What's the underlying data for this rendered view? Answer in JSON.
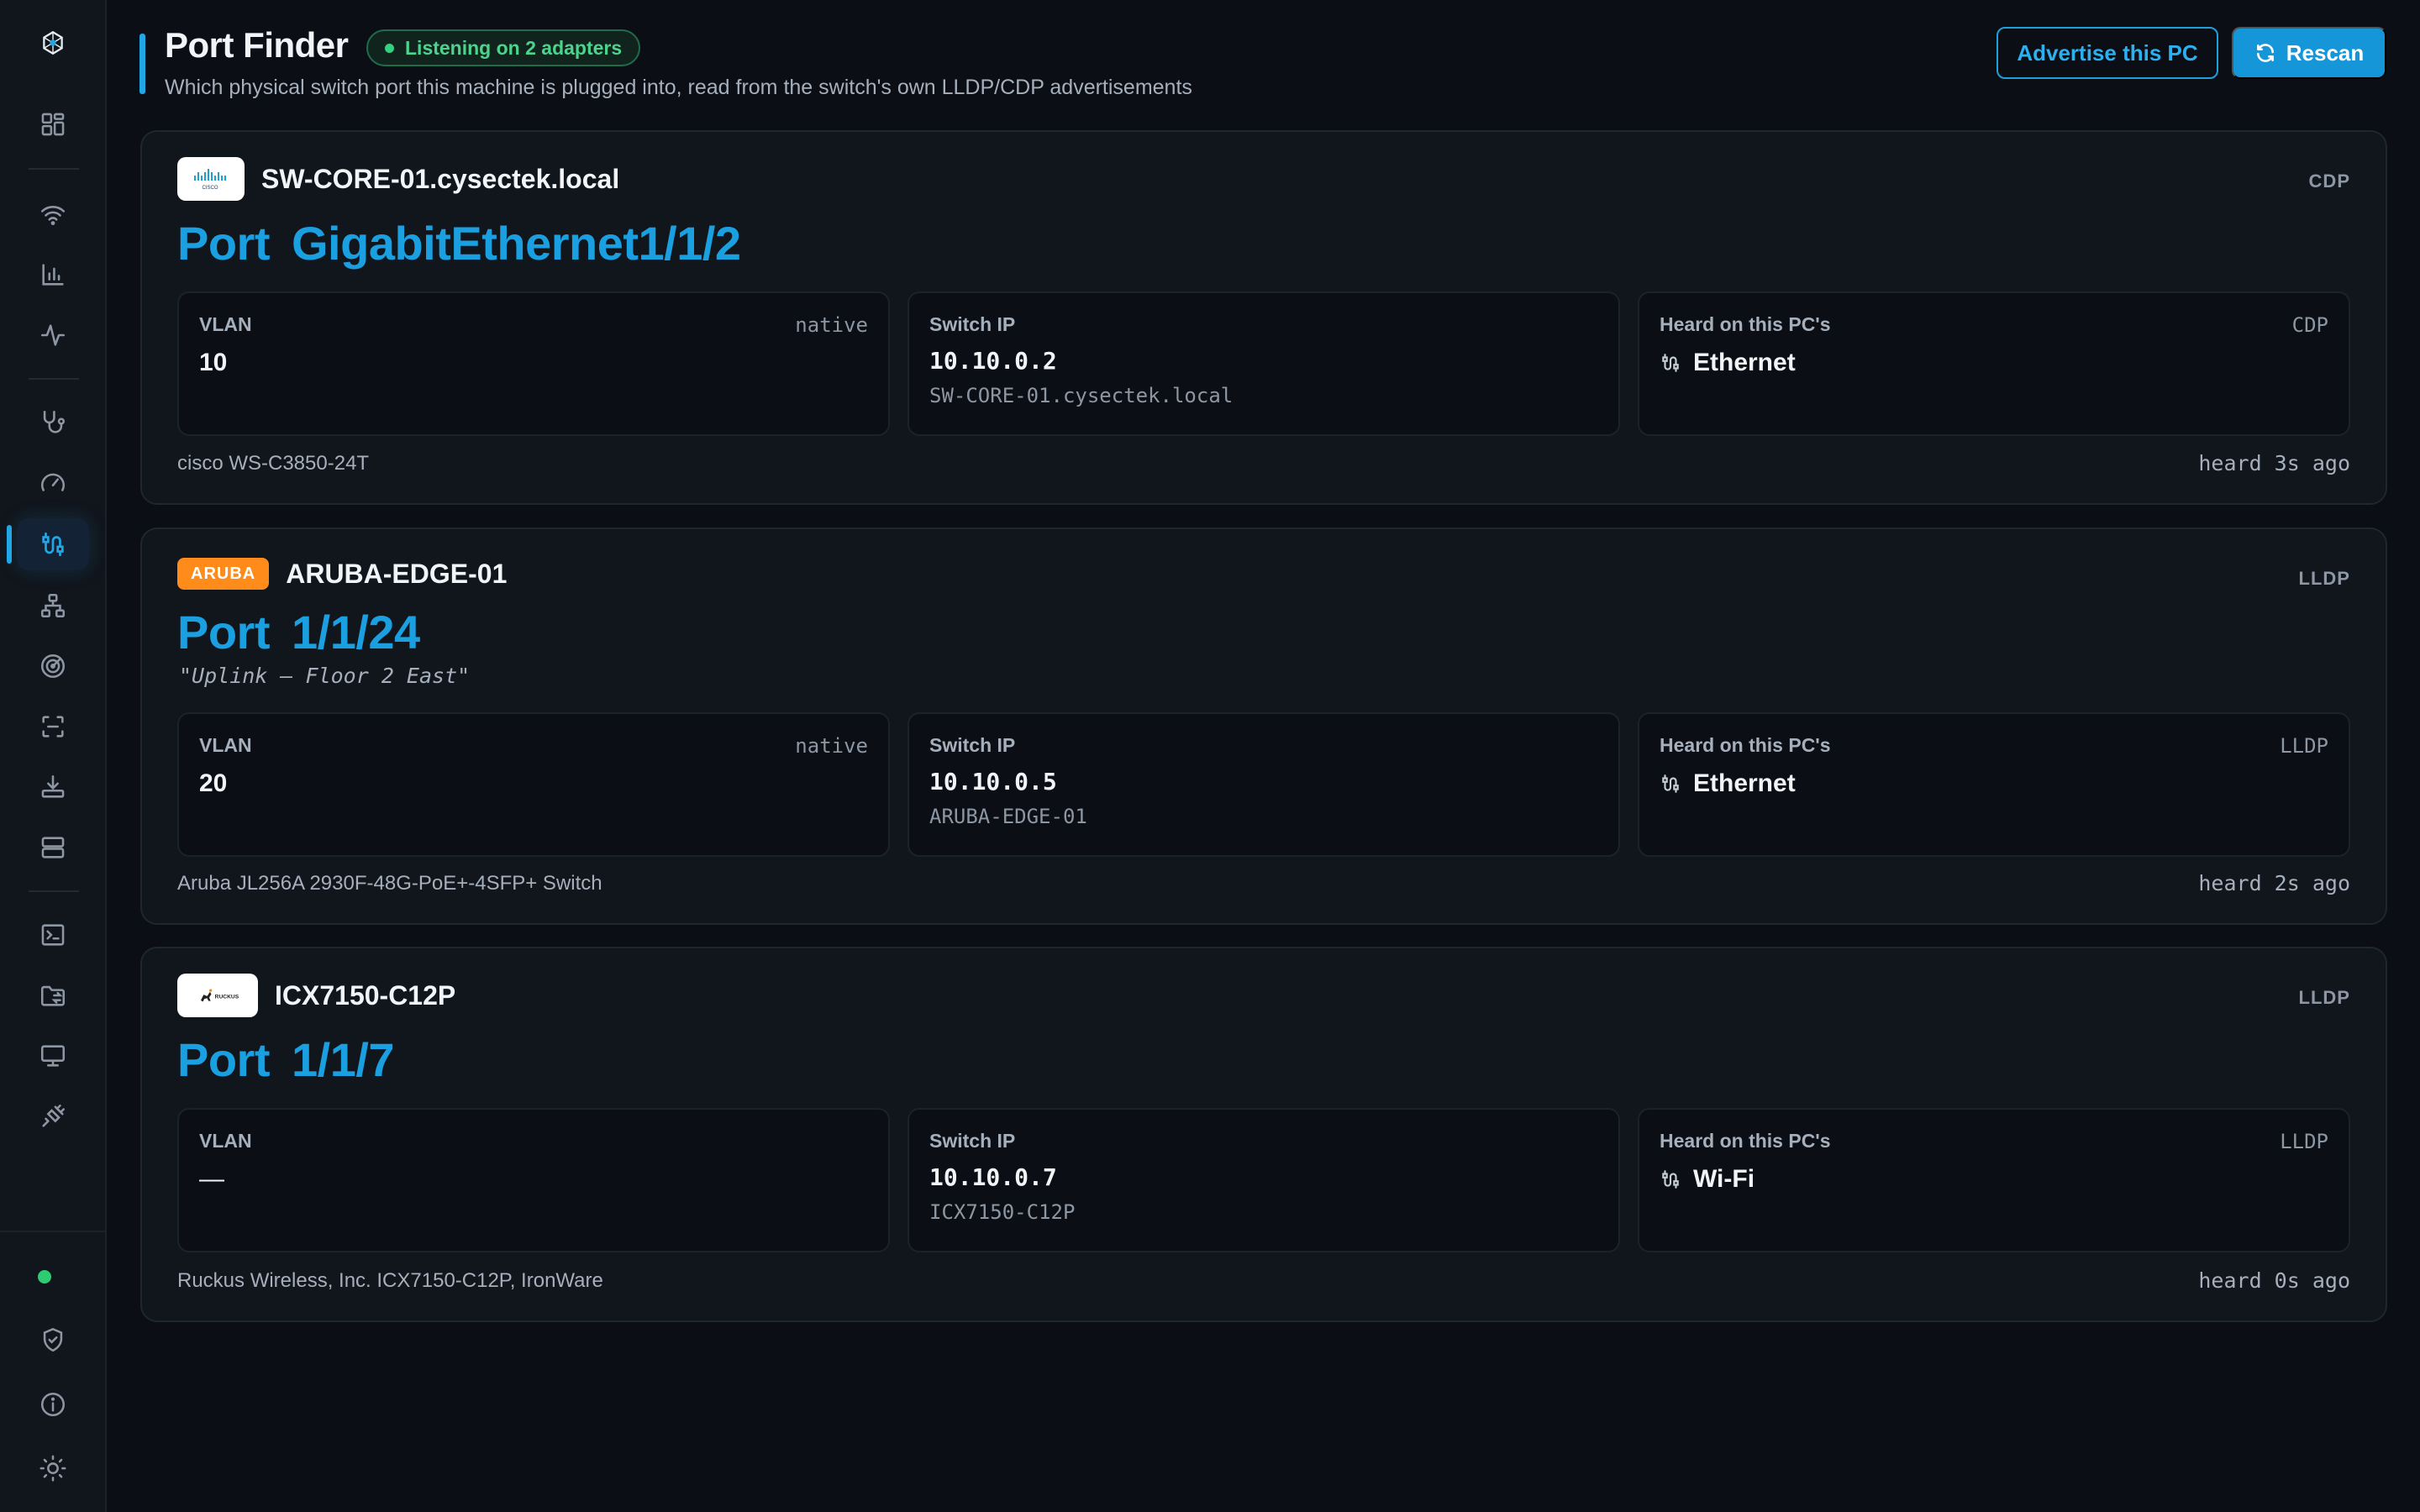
{
  "header": {
    "title": "Port Finder",
    "status_pill": "Listening on 2 adapters",
    "subtitle": "Which physical switch port this machine is plugged into, read from the switch's own LLDP/CDP advertisements",
    "advertise_label": "Advertise this PC",
    "rescan_label": "Rescan"
  },
  "colors": {
    "accent": "#1aa0e0",
    "background": "#0b0e14",
    "card": "#11151c",
    "status_green": "#34d17e",
    "aruba_orange": "#ff8c1a"
  },
  "sidebar": {
    "items": [
      {
        "icon": "logo-icon"
      },
      {
        "icon": "dashboard-icon"
      },
      {
        "icon": "wifi-icon"
      },
      {
        "icon": "bar-chart-icon"
      },
      {
        "icon": "activity-icon"
      },
      {
        "icon": "stethoscope-icon"
      },
      {
        "icon": "speed-gauge-icon"
      },
      {
        "icon": "port-finder-icon",
        "active": true
      },
      {
        "icon": "topology-icon"
      },
      {
        "icon": "radar-icon"
      },
      {
        "icon": "scan-icon"
      },
      {
        "icon": "download-icon"
      },
      {
        "icon": "server-icon"
      },
      {
        "icon": "terminal-icon"
      },
      {
        "icon": "folder-share-icon"
      },
      {
        "icon": "monitor-icon"
      },
      {
        "icon": "cable-icon"
      },
      {
        "icon": "status-dot"
      },
      {
        "icon": "shield-check-icon"
      },
      {
        "icon": "info-icon"
      },
      {
        "icon": "sun-icon"
      }
    ]
  },
  "labels": {
    "port": "Port",
    "vlan": "VLAN",
    "switch_ip": "Switch IP",
    "heard_on": "Heard on this PC's"
  },
  "cards": [
    {
      "vendor_icon": "cisco-logo",
      "switch_name": "SW-CORE-01.cysectek.local",
      "protocol": "CDP",
      "port": "GigabitEthernet1/1/2",
      "vlan": "10",
      "vlan_tag": "native",
      "switch_ip": "10.10.0.2",
      "switch_host": "SW-CORE-01.cysectek.local",
      "heard_tag": "CDP",
      "interface": "Ethernet",
      "model": "cisco WS-C3850-24T",
      "heard": "heard 3s ago"
    },
    {
      "vendor_badge": "ARUBA",
      "switch_name": "ARUBA-EDGE-01",
      "protocol": "LLDP",
      "port": "1/1/24",
      "port_description": "\"Uplink — Floor 2 East\"",
      "vlan": "20",
      "vlan_tag": "native",
      "switch_ip": "10.10.0.5",
      "switch_host": "ARUBA-EDGE-01",
      "heard_tag": "LLDP",
      "interface": "Ethernet",
      "model": "Aruba JL256A 2930F-48G-PoE+-4SFP+ Switch",
      "heard": "heard 2s ago"
    },
    {
      "vendor_icon": "ruckus-logo",
      "switch_name": "ICX7150-C12P",
      "protocol": "LLDP",
      "port": "1/1/7",
      "vlan": "—",
      "switch_ip": "10.10.0.7",
      "switch_host": "ICX7150-C12P",
      "heard_tag": "LLDP",
      "interface": "Wi-Fi",
      "model": "Ruckus Wireless, Inc. ICX7150-C12P, IronWare",
      "heard": "heard 0s ago"
    }
  ]
}
